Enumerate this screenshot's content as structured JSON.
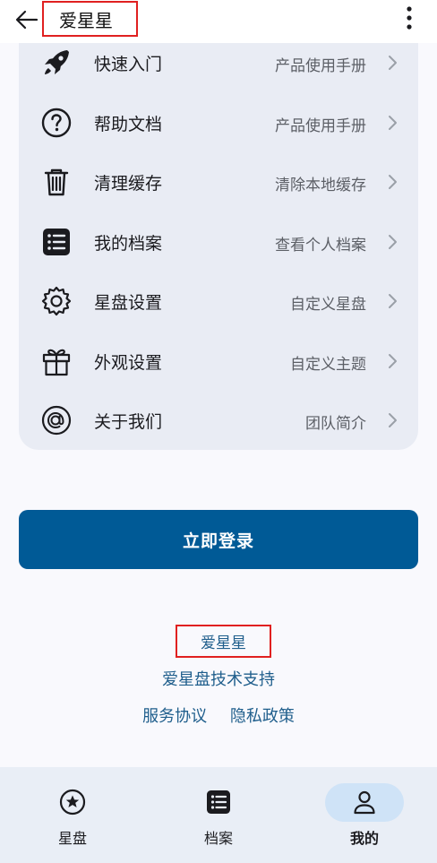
{
  "header": {
    "title": "爱星星"
  },
  "menu": {
    "items": [
      {
        "label": "快速入门",
        "sub": "产品使用手册"
      },
      {
        "label": "帮助文档",
        "sub": "产品使用手册"
      },
      {
        "label": "清理缓存",
        "sub": "清除本地缓存"
      },
      {
        "label": "我的档案",
        "sub": "查看个人档案"
      },
      {
        "label": "星盘设置",
        "sub": "自定义星盘"
      },
      {
        "label": "外观设置",
        "sub": "自定义主题"
      },
      {
        "label": "关于我们",
        "sub": "团队简介"
      }
    ]
  },
  "login": {
    "label": "立即登录"
  },
  "footer": {
    "brand": "爱星星",
    "support": "爱星盘技术支持",
    "terms": "服务协议",
    "privacy": "隐私政策"
  },
  "nav": {
    "items": [
      {
        "label": "星盘"
      },
      {
        "label": "档案"
      },
      {
        "label": "我的"
      }
    ]
  },
  "colors": {
    "primary": "#005a96",
    "link": "#1f5e8c",
    "card": "#e9ecf4",
    "highlight_box": "#e02020",
    "nav_bg": "#e9eef6",
    "nav_active": "#cfe3f7"
  }
}
